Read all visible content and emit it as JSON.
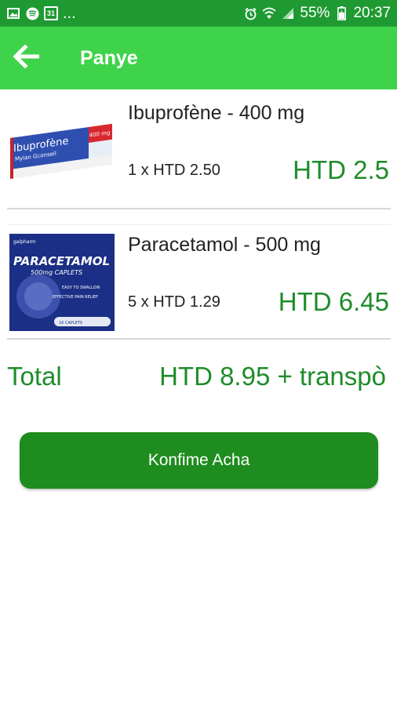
{
  "status_bar": {
    "left_icons": [
      "image-icon",
      "spotify-icon",
      "calendar-icon"
    ],
    "calendar_day": "31",
    "ellipsis": "...",
    "right_icons": [
      "alarm-icon",
      "wifi-icon",
      "signal-icon",
      "battery-icon"
    ],
    "battery": "55%",
    "time": "20:37"
  },
  "app_bar": {
    "title": "Panye",
    "back_icon": "arrow-left-icon"
  },
  "cart": {
    "items": [
      {
        "name": "Ibuprofène - 400 mg",
        "qty_line": "1 x HTD 2.50",
        "line_total": "HTD 2.5",
        "thumbnail": {
          "brand": "Ibuprofène",
          "subbrand": "Mylan Gconseil",
          "badge": "400 mg"
        }
      },
      {
        "name": "Paracetamol - 500 mg",
        "qty_line": "5 x HTD 1.29",
        "line_total": "HTD 6.45",
        "thumbnail": {
          "maker": "galpharm",
          "brand": "PARACETAMOL",
          "subtitle": "500mg CAPLETS",
          "tagline_1": "EASY TO SWALLOW",
          "tagline_2": "EFFECTIVE PAIN RELIEF",
          "count": "16 CAPLETS"
        }
      }
    ]
  },
  "totals": {
    "label": "Total",
    "value": "HTD 8.95 + transpò"
  },
  "actions": {
    "confirm_label": "Konfime Acha"
  },
  "colors": {
    "status_bar": "#1f9a32",
    "app_bar": "#3fd34b",
    "accent_text": "#1e8c2a",
    "button": "#1e8c1e"
  }
}
